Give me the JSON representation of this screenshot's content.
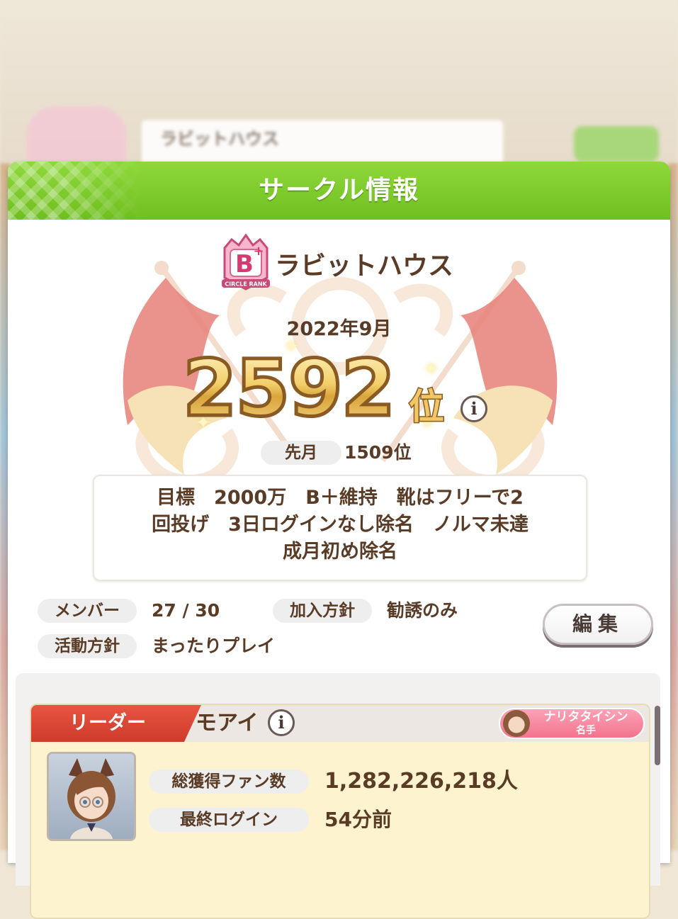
{
  "background": {
    "circle_name": "ラビットハウス"
  },
  "dialog": {
    "title": "サークル情報",
    "rank_badge_letter": "B",
    "rank_badge_caption": "CIRCLE RANK",
    "circle_name": "ラビットハウス",
    "month": "2022年9月",
    "rank_number": "2592",
    "rank_suffix": "位",
    "last_month_label": "先月",
    "last_month_value": "1509位",
    "comment": "目標　2000万　B＋維持　靴はフリーで2\n回投げ　3日ログインなし除名　ノルマ未達\n成月初め除名",
    "members_label": "メンバー",
    "members_value": "27 / 30",
    "join_policy_label": "加入方針",
    "join_policy_value": "勧誘のみ",
    "activity_policy_label": "活動方針",
    "activity_policy_value": "まったりプレイ",
    "edit_button": "編集"
  },
  "leader": {
    "ribbon": "リーダー",
    "name": "モアイ",
    "character_name": "ナリタタイシン",
    "character_title": "名手",
    "fans_label": "総獲得ファン数",
    "fans_value": "1,282,226,218人",
    "last_login_label": "最終ログイン",
    "last_login_value": "54分前"
  },
  "colors": {
    "header_green": "#7cc92a",
    "text_brown": "#5a3b26",
    "ribbon_red": "#d8402f",
    "gold": "#f0c560"
  },
  "icons": [
    "info-icon",
    "rank-badge-icon",
    "sparkle-icon",
    "flag-emblem"
  ]
}
